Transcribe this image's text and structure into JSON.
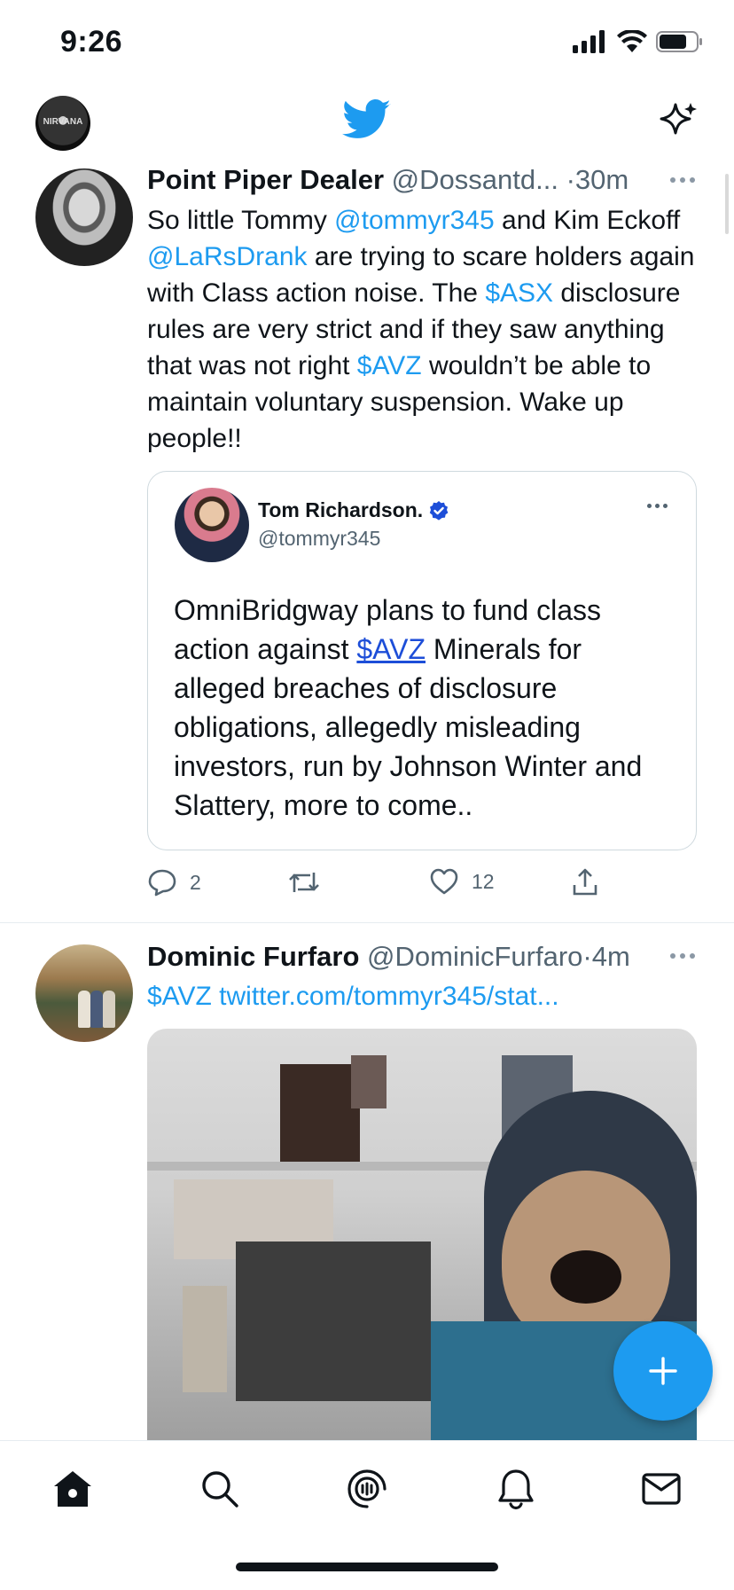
{
  "status_bar": {
    "time": "9:26"
  },
  "header": {
    "avatar_text": "NIRVANA"
  },
  "tweets": [
    {
      "name": "Point Piper Dealer",
      "handle": "@Dossantd...",
      "dot": "·",
      "age": "30m",
      "body": {
        "p1": "So little Tommy ",
        "m1": "@tommyr345",
        "p2": " and Kim Eckoff ",
        "m2": "@LaRsDrank",
        "p3": " are trying to scare holders again with Class action noise. The ",
        "c1": "$ASX",
        "p4": " disclosure rules are very strict and if they saw anything that was not right ",
        "c2": "$AVZ",
        "p5": " wouldn’t be able to maintain voluntary suspension. Wake up people!!"
      },
      "quote": {
        "name": "Tom Richardson.",
        "handle": "@tommyr345",
        "text_before": "OmniBridgway plans to fund class action against ",
        "cashtag": "$AVZ",
        "text_after": " Minerals for alleged breaches of disclosure obligations, allegedly misleading investors, run by Johnson Winter and Slattery, more to come.."
      },
      "replies": "2",
      "retweets": "",
      "likes": "12"
    },
    {
      "name": "Dominic Furfaro",
      "handle": "@DominicFurfaro",
      "dot": "·",
      "age": "4m",
      "cashtag": "$AVZ",
      "link": "twitter.com/tommyr345/stat..."
    }
  ],
  "colors": {
    "accent": "#1d9bf0",
    "text": "#0f1419",
    "muted": "#536471",
    "border": "#cfd9de"
  },
  "icons": [
    "twitter-bird-icon",
    "sparkle-icon",
    "reply-icon",
    "retweet-icon",
    "like-icon",
    "share-icon",
    "home-icon",
    "search-icon",
    "spaces-icon",
    "notifications-icon",
    "messages-icon",
    "compose-plus-icon",
    "verified-badge-icon"
  ]
}
